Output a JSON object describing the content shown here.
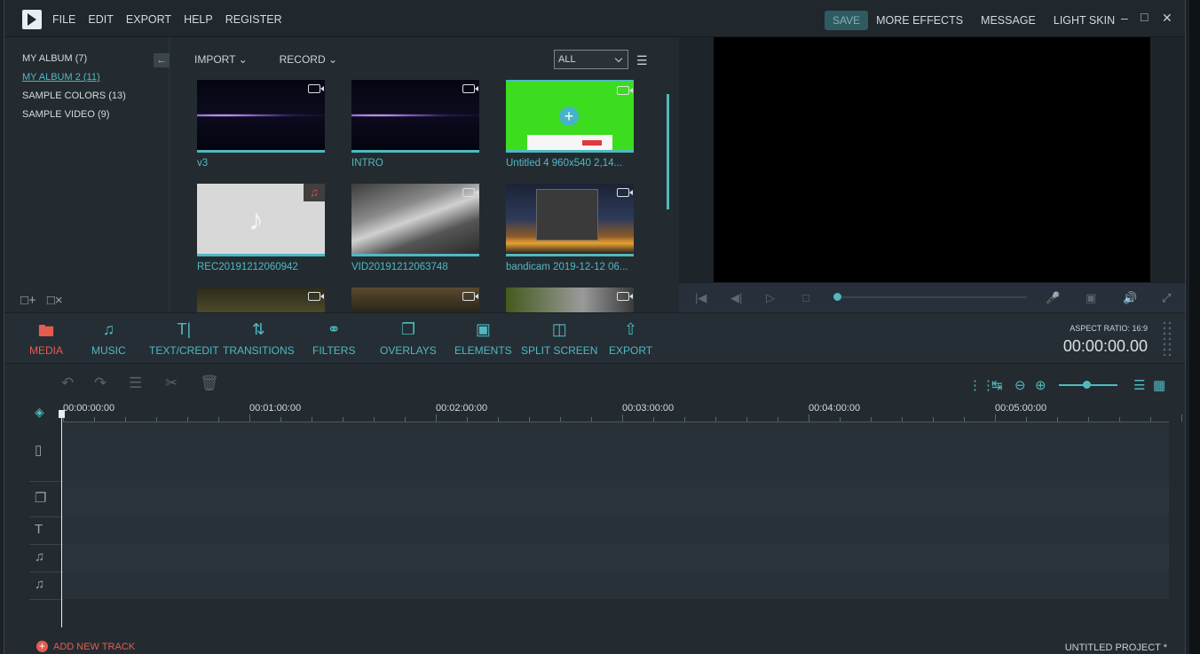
{
  "app": {
    "menu": [
      "FILE",
      "EDIT",
      "EXPORT",
      "HELP",
      "REGISTER"
    ],
    "save_label": "SAVE",
    "more_effects": "MORE EFFECTS",
    "message": "MESSAGE",
    "light_skin": "LIGHT SKIN",
    "minimize": "–",
    "maximize": "□",
    "close": "✕"
  },
  "albums": [
    {
      "label": "MY ALBUM (7)",
      "active": false
    },
    {
      "label": "MY ALBUM 2 (11)",
      "active": true
    },
    {
      "label": "SAMPLE COLORS (13)",
      "active": false
    },
    {
      "label": "SAMPLE VIDEO (9)",
      "active": false
    }
  ],
  "library": {
    "import": "IMPORT",
    "record": "RECORD",
    "filter": "ALL",
    "items": [
      {
        "label": "v3",
        "type": "video"
      },
      {
        "label": "INTRO",
        "type": "video"
      },
      {
        "label": "Untitled 4 960x540 2,14...",
        "type": "video"
      },
      {
        "label": "REC20191212060942",
        "type": "audio"
      },
      {
        "label": "VID20191212063748",
        "type": "video"
      },
      {
        "label": "bandicam 2019-12-12 06...",
        "type": "video"
      },
      {
        "label": "",
        "type": "video"
      },
      {
        "label": "",
        "type": "video"
      },
      {
        "label": "",
        "type": "video"
      }
    ]
  },
  "toolbar": {
    "items": [
      {
        "label": "MEDIA",
        "icon": "folder-icon"
      },
      {
        "label": "MUSIC",
        "icon": "music-note-icon"
      },
      {
        "label": "TEXT/CREDIT",
        "icon": "text-icon"
      },
      {
        "label": "TRANSITIONS",
        "icon": "transitions-icon"
      },
      {
        "label": "FILTERS",
        "icon": "filters-icon"
      },
      {
        "label": "OVERLAYS",
        "icon": "overlays-icon"
      },
      {
        "label": "ELEMENTS",
        "icon": "elements-icon"
      },
      {
        "label": "SPLIT SCREEN",
        "icon": "split-screen-icon"
      },
      {
        "label": "EXPORT",
        "icon": "export-icon"
      }
    ],
    "aspect_ratio": "ASPECT RATIO: 16:9",
    "timecode": "00:00:00.00"
  },
  "timeline": {
    "ruler": [
      "00:00:00:00",
      "00:01:00:00",
      "00:02:00:00",
      "00:03:00:00",
      "00:04:00:00",
      "00:05:00:00"
    ],
    "add_track": "ADD NEW TRACK",
    "project": "UNTITLED PROJECT *",
    "zoom_level": 0.45
  },
  "colors": {
    "accent": "#4fb9c0",
    "active": "#e55c4f",
    "background": "#232b31"
  }
}
